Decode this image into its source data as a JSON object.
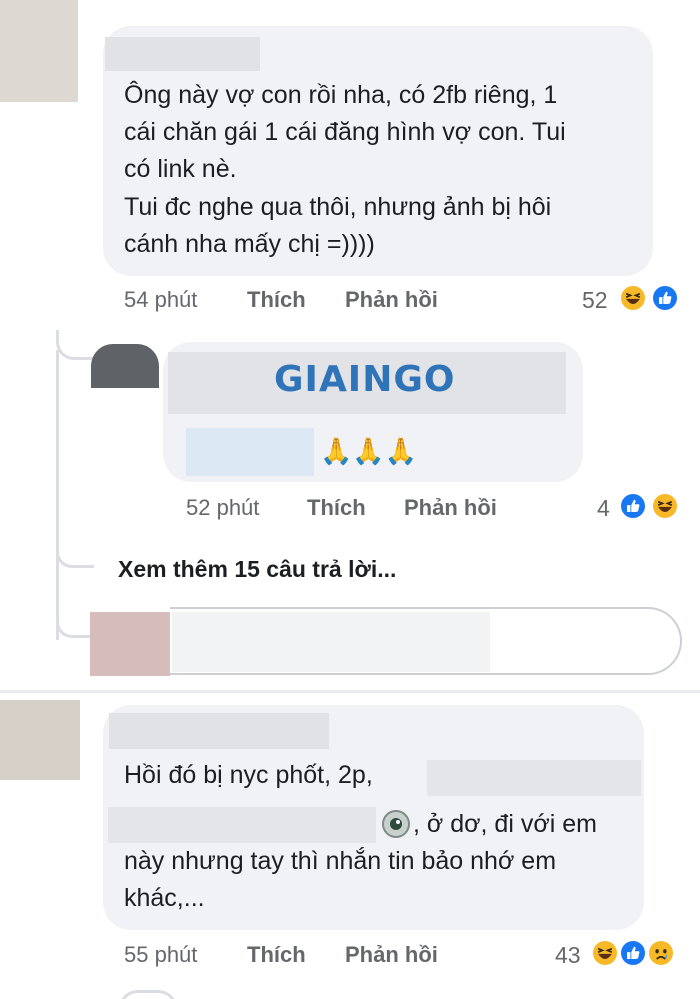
{
  "watermark": "GIAINGO",
  "comments": [
    {
      "lines": [
        "Ông này vợ con rồi nha, có 2fb riêng, 1",
        "cái chăn gái 1 cái đăng hình vợ con. Tui",
        "có link nè.",
        "Tui đc nghe qua thôi, nhưng ảnh bị hôi",
        "cánh nha mấy chị =))))"
      ],
      "time": "54 phút",
      "like": "Thích",
      "reply": "Phản hồi",
      "reaction_count": "52",
      "reaction_icons": [
        "haha-icon",
        "like-icon"
      ]
    },
    {
      "emoji": "🙏🙏🙏",
      "time": "52 phút",
      "like": "Thích",
      "reply": "Phản hồi",
      "reaction_count": "4",
      "reaction_icons": [
        "like-icon",
        "haha-icon"
      ]
    },
    {
      "line1": "Hồi đó bị nyc phốt, 2p,",
      "line2_suffix": ", ở dơ, đi với em",
      "line3": "này nhưng tay thì nhắn tin bảo nhớ em",
      "line4": "khác,...",
      "time": "55 phút",
      "like": "Thích",
      "reply": "Phản hồi",
      "reaction_count": "43",
      "reaction_icons": [
        "haha-icon",
        "like-icon",
        "sad-icon"
      ]
    }
  ],
  "view_more": "Xem thêm 15 câu trả lời...",
  "colors": {
    "bubble": "#f0f2f5",
    "meta": "#65676b",
    "like_blue": "#1877f2",
    "haha_yellow": "#f7b928",
    "watermark": "#2f73b8"
  }
}
